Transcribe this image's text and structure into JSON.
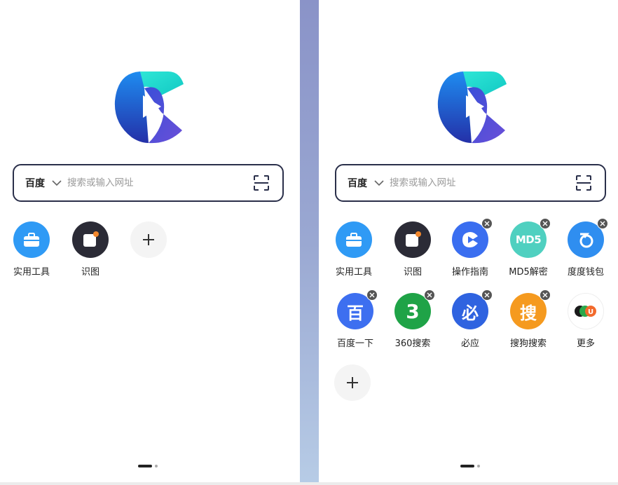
{
  "search": {
    "engine": "百度",
    "placeholder": "搜索或输入网址"
  },
  "left_panel": {
    "shortcuts": [
      {
        "label": "实用工具",
        "icon": "toolbox-icon",
        "color": "#2f9af5"
      },
      {
        "label": "识图",
        "icon": "image-recognition-icon",
        "color": "#2b2b36"
      }
    ]
  },
  "right_panel": {
    "shortcuts": [
      {
        "label": "实用工具",
        "icon": "toolbox-icon",
        "color": "#2f9af5"
      },
      {
        "label": "识图",
        "icon": "image-recognition-icon",
        "color": "#2b2b36"
      },
      {
        "label": "操作指南",
        "icon": "guide-play-icon",
        "color": "#3a6ef0"
      },
      {
        "label": "MD5解密",
        "icon": "md5-icon",
        "color": "#4fd0c0",
        "glyph": "MD5"
      },
      {
        "label": "度度钱包",
        "icon": "wallet-icon",
        "color": "#2f8ef0"
      },
      {
        "label": "百度一下",
        "icon": "baidu-icon",
        "color": "#3d6ff0",
        "glyph": "百"
      },
      {
        "label": "360搜索",
        "icon": "search-360-icon",
        "color": "#1fa347",
        "glyph": "3"
      },
      {
        "label": "必应",
        "icon": "bing-icon",
        "color": "#2f63e0",
        "glyph": "必"
      },
      {
        "label": "搜狗搜索",
        "icon": "sogou-icon",
        "color": "#f59a1f",
        "glyph": "搜"
      },
      {
        "label": "更多",
        "icon": "more-apps-icon",
        "color": "#ffffff"
      }
    ]
  }
}
